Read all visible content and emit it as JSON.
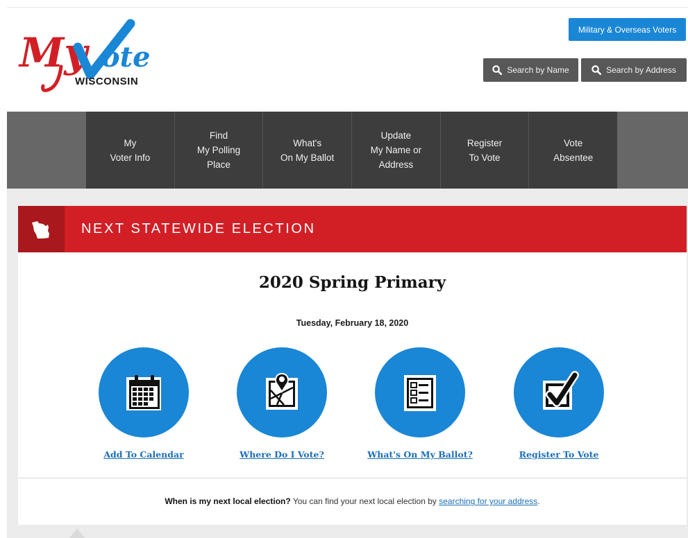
{
  "logo": {
    "text_my": "My",
    "text_vote": "Vote",
    "text_state": "WISCONSIN",
    "colors": {
      "red": "#d21f26",
      "blue": "#1a86d6",
      "dark": "#1a1a1a"
    }
  },
  "header": {
    "military_label": "Military & Overseas Voters",
    "search_name_label": "Search by Name",
    "search_address_label": "Search by Address",
    "search_icon": "search-icon"
  },
  "nav": {
    "items": [
      {
        "label": "My\nVoter Info"
      },
      {
        "label": "Find\nMy Polling\nPlace"
      },
      {
        "label": "What's\nOn My Ballot"
      },
      {
        "label": "Update\nMy Name or\nAddress"
      },
      {
        "label": "Register\nTo Vote"
      },
      {
        "label": "Vote\nAbsentee"
      }
    ]
  },
  "banner": {
    "icon": "wisconsin-state-icon",
    "title": "NEXT STATEWIDE ELECTION"
  },
  "election": {
    "name": "2020 Spring Primary",
    "date": "Tuesday, February 18, 2020"
  },
  "actions": [
    {
      "icon": "calendar-icon",
      "label": "Add To Calendar"
    },
    {
      "icon": "map-pin-icon",
      "label": "Where Do I Vote?"
    },
    {
      "icon": "ballot-list-icon",
      "label": "What's On My Ballot?"
    },
    {
      "icon": "checkbox-icon",
      "label": "Register To Vote"
    }
  ],
  "local": {
    "question": "When is my next local election?",
    "text": " You can find your next local election by ",
    "link": "searching for your address",
    "end": "."
  },
  "colors": {
    "accent_blue": "#1a86d6",
    "banner_red": "#d21f26",
    "nav_dark": "#3d3d3d",
    "link_blue": "#1a6fb8"
  }
}
